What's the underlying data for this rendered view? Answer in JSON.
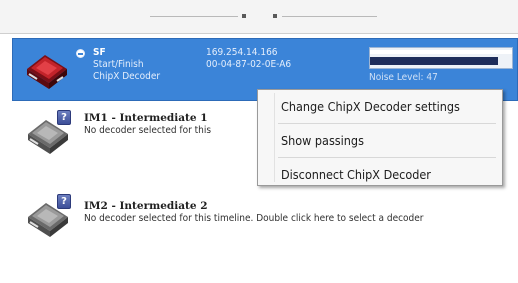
{
  "decoders": [
    {
      "name": "SF",
      "subtitle": "Start/Finish",
      "type": "ChipX Decoder",
      "ip": "169.254.14.166",
      "mac": "00-04-87-02-0E-A6",
      "noise": "Noise Level: 47",
      "signal_level": 0.9,
      "status": "connected",
      "selected": true
    },
    {
      "name": "IM1 - Intermediate 1",
      "description": "No decoder selected for this",
      "status": "none"
    },
    {
      "name": "IM2 - Intermediate 2",
      "description": "No decoder selected for this timeline. Double click here to select a decoder",
      "status": "none"
    }
  ],
  "help_badge_glyph": "?",
  "context_menu": {
    "items": [
      "Change ChipX Decoder settings",
      "Show passings",
      "Disconnect ChipX Decoder"
    ]
  },
  "colors": {
    "selection": "#3b84d8",
    "connected_icon": "#c2232a",
    "idle_icon": "#8a8a8a"
  }
}
